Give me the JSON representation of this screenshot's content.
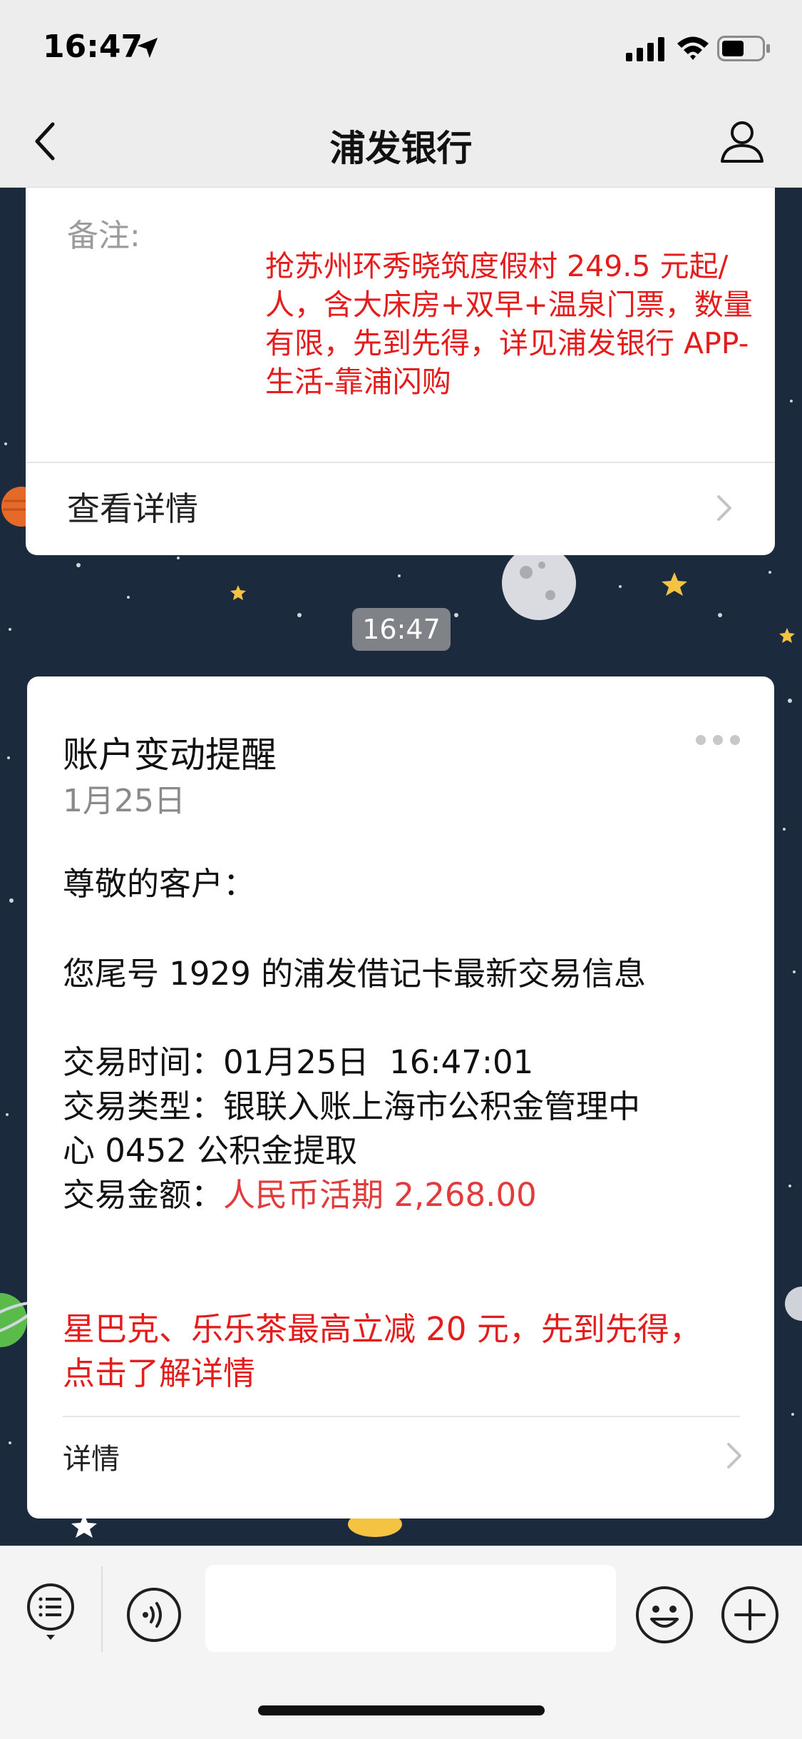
{
  "status_bar": {
    "time": "16:47"
  },
  "nav": {
    "title": "浦发银行"
  },
  "card1": {
    "remark_label": "备注:",
    "remark_text": "抢苏州环秀晓筑度假村 249.5 元起/人，含大床房+双早+温泉门票，数量有限，先到先得，详见浦发银行 APP-生活-靠浦闪购",
    "detail_link": "查看详情"
  },
  "timestamp": "16:47",
  "card2": {
    "title": "账户变动提醒",
    "date": "1月25日",
    "greeting": "尊敬的客户：",
    "intro": "您尾号 1929 的浦发借记卡最新交易信息",
    "time_label": "交易时间：",
    "time_value": "01月25日  16:47:01",
    "type_label": "交易类型：",
    "type_value_line1": "银联入账上海市公积金管理中",
    "type_value_line2": "心 0452 公积金提取",
    "amount_label": "交易金额：",
    "amount_value": "人民币活期 2,268.00",
    "promo": "星巴克、乐乐茶最高立减 20 元，先到先得，点击了解详情",
    "detail_link": "详情"
  },
  "input_bar": {
    "placeholder": ""
  },
  "colors": {
    "accent_red": "#e41c1c",
    "amount_red": "#e23b3b",
    "chat_background": "#1c2a3e"
  },
  "icons": [
    "location-arrow-icon",
    "signal-icon",
    "wifi-icon",
    "battery-icon",
    "back-icon",
    "profile-icon",
    "more-icon",
    "chevron-right-icon",
    "menu-icon",
    "voice-icon",
    "emoji-icon",
    "plus-icon"
  ]
}
